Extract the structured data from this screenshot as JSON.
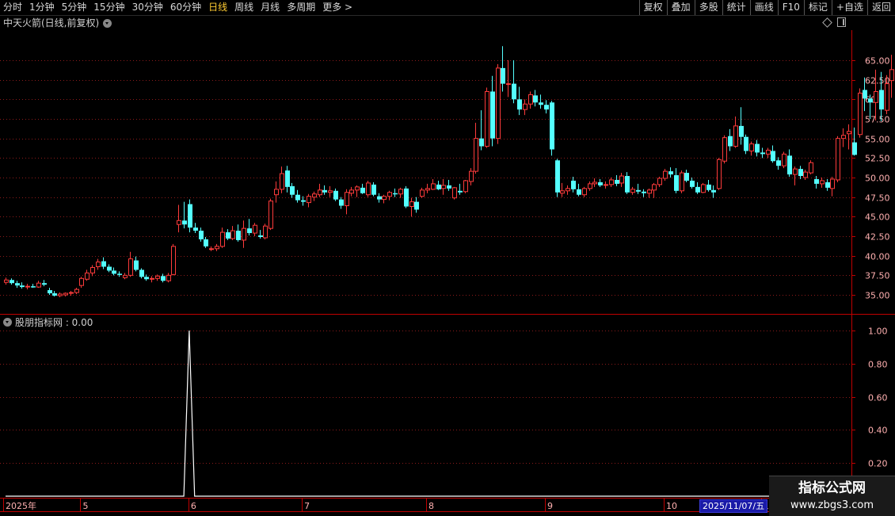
{
  "toolbar": {
    "left": [
      "分时",
      "1分钟",
      "5分钟",
      "15分钟",
      "30分钟",
      "60分钟",
      "日线",
      "周线",
      "月线",
      "多周期",
      "更多 >"
    ],
    "active": "日线",
    "right": [
      "复权",
      "叠加",
      "多股",
      "统计",
      "画线",
      "F10",
      "标记",
      "+自选",
      "返回"
    ]
  },
  "main_title": "中天火箭(日线,前复权)",
  "indicator_title": "股朋指标网 : 0.00",
  "date_highlight": "2025/11/07/五",
  "watermark": {
    "line1": "指标公式网",
    "line2": "www.zbgs3.com"
  },
  "colors": {
    "up": "#ff3b3b",
    "down": "#54ffff",
    "axis": "#c00000",
    "grid": "#8b1a1a",
    "label": "#ffb0b0",
    "line": "#ffffff"
  },
  "chart_data": [
    {
      "type": "candlestick",
      "title": "中天火箭(日线,前复权)",
      "ylim": [
        33.5,
        67.5
      ],
      "y_ticks": [
        "65.00",
        "62.50",
        "60.00",
        "57.50",
        "55.00",
        "52.50",
        "50.00",
        "47.50",
        "45.00",
        "42.50",
        "40.00",
        "37.50",
        "35.00"
      ],
      "x_labels": [
        {
          "label": "2025年",
          "index": 0
        },
        {
          "label": "5",
          "index": 14
        },
        {
          "label": "6",
          "index": 34
        },
        {
          "label": "7",
          "index": 55
        },
        {
          "label": "8",
          "index": 78
        },
        {
          "label": "9",
          "index": 100
        },
        {
          "label": "10",
          "index": 122
        },
        {
          "label": "11",
          "index": 140
        }
      ],
      "ohlc": [
        [
          36.6,
          37.2,
          36.3,
          36.9
        ],
        [
          36.9,
          37.1,
          36.3,
          36.5
        ],
        [
          36.5,
          36.8,
          35.9,
          36.2
        ],
        [
          36.2,
          36.6,
          35.8,
          36.0
        ],
        [
          36.0,
          36.4,
          35.7,
          36.1
        ],
        [
          36.1,
          36.4,
          35.9,
          36.0
        ],
        [
          36.0,
          36.8,
          35.9,
          36.5
        ],
        [
          36.5,
          36.9,
          36.1,
          36.3
        ],
        [
          35.6,
          35.9,
          35.0,
          35.2
        ],
        [
          35.2,
          35.5,
          34.8,
          34.9
        ],
        [
          34.9,
          35.3,
          34.7,
          35.1
        ],
        [
          35.0,
          35.3,
          34.8,
          35.2
        ],
        [
          35.2,
          35.5,
          34.9,
          35.3
        ],
        [
          35.3,
          35.9,
          35.1,
          35.7
        ],
        [
          36.2,
          37.3,
          35.9,
          37.1
        ],
        [
          37.0,
          38.2,
          36.8,
          37.8
        ],
        [
          37.8,
          38.8,
          37.4,
          38.5
        ],
        [
          38.6,
          39.6,
          38.2,
          39.2
        ],
        [
          39.3,
          39.8,
          38.3,
          38.6
        ],
        [
          38.6,
          38.9,
          37.9,
          38.1
        ],
        [
          38.1,
          38.5,
          37.5,
          37.7
        ],
        [
          37.7,
          38.0,
          37.3,
          37.6
        ],
        [
          37.2,
          37.8,
          37.0,
          37.5
        ],
        [
          37.5,
          40.5,
          37.3,
          39.6
        ],
        [
          39.4,
          39.9,
          38.0,
          38.2
        ],
        [
          38.2,
          38.4,
          37.1,
          37.3
        ],
        [
          37.3,
          37.6,
          36.8,
          37.0
        ],
        [
          37.0,
          37.4,
          36.6,
          37.1
        ],
        [
          37.1,
          37.6,
          36.8,
          37.4
        ],
        [
          37.4,
          37.7,
          36.6,
          36.8
        ],
        [
          36.8,
          37.8,
          36.6,
          37.5
        ],
        [
          37.6,
          41.5,
          37.5,
          41.2
        ],
        [
          44.0,
          46.5,
          43.0,
          44.5
        ],
        [
          44.5,
          46.9,
          43.5,
          44.0
        ],
        [
          46.6,
          47.2,
          43.0,
          43.6
        ],
        [
          43.6,
          44.2,
          42.9,
          43.2
        ],
        [
          43.2,
          43.6,
          41.8,
          42.1
        ],
        [
          42.1,
          42.4,
          41.0,
          41.2
        ],
        [
          40.8,
          41.2,
          40.6,
          40.9
        ],
        [
          40.9,
          41.5,
          40.6,
          41.2
        ],
        [
          41.2,
          43.6,
          41.0,
          43.0
        ],
        [
          43.0,
          43.4,
          42.0,
          42.2
        ],
        [
          42.2,
          43.8,
          42.0,
          43.2
        ],
        [
          43.2,
          44.0,
          41.8,
          42.0
        ],
        [
          42.0,
          44.5,
          41.0,
          43.5
        ],
        [
          43.5,
          44.7,
          42.6,
          42.9
        ],
        [
          42.9,
          44.2,
          42.5,
          43.9
        ],
        [
          42.6,
          43.3,
          42.2,
          42.4
        ],
        [
          42.3,
          44.1,
          42.1,
          43.8
        ],
        [
          43.5,
          47.3,
          43.3,
          47.0
        ],
        [
          47.8,
          49.5,
          46.8,
          48.5
        ],
        [
          48.5,
          51.4,
          48.0,
          50.5
        ],
        [
          50.9,
          51.5,
          48.1,
          48.8
        ],
        [
          48.9,
          49.3,
          47.4,
          47.8
        ],
        [
          47.8,
          48.4,
          46.8,
          47.1
        ],
        [
          47.1,
          47.6,
          46.4,
          46.9
        ],
        [
          46.8,
          47.9,
          46.2,
          47.6
        ],
        [
          47.5,
          48.2,
          47.0,
          47.9
        ],
        [
          47.8,
          49.2,
          47.5,
          48.4
        ],
        [
          48.4,
          49.0,
          47.8,
          48.1
        ],
        [
          48.1,
          48.9,
          47.5,
          48.3
        ],
        [
          48.3,
          48.6,
          47.0,
          47.2
        ],
        [
          47.2,
          47.5,
          46.0,
          46.4
        ],
        [
          46.4,
          48.5,
          45.3,
          48.1
        ],
        [
          48.0,
          48.8,
          47.6,
          48.4
        ],
        [
          48.4,
          49.0,
          47.5,
          48.8
        ],
        [
          48.7,
          49.2,
          47.9,
          48.0
        ],
        [
          47.8,
          49.6,
          47.5,
          49.3
        ],
        [
          49.1,
          49.4,
          47.6,
          47.8
        ],
        [
          47.6,
          48.0,
          46.8,
          47.2
        ],
        [
          47.2,
          47.8,
          46.7,
          47.6
        ],
        [
          47.6,
          48.3,
          47.1,
          48.1
        ],
        [
          48.0,
          48.6,
          47.5,
          47.9
        ],
        [
          47.9,
          48.7,
          47.4,
          48.5
        ],
        [
          48.6,
          48.9,
          46.1,
          46.3
        ],
        [
          46.3,
          47.4,
          45.0,
          46.9
        ],
        [
          46.9,
          47.5,
          45.5,
          45.9
        ],
        [
          47.6,
          48.7,
          47.4,
          48.4
        ],
        [
          48.4,
          49.2,
          48.0,
          48.6
        ],
        [
          48.5,
          49.8,
          48.4,
          49.2
        ],
        [
          49.1,
          49.6,
          48.4,
          48.5
        ],
        [
          48.6,
          49.8,
          47.8,
          49.0
        ],
        [
          49.0,
          49.7,
          48.3,
          48.6
        ],
        [
          47.4,
          48.8,
          47.2,
          48.7
        ],
        [
          48.3,
          49.2,
          47.8,
          48.1
        ],
        [
          48.2,
          49.7,
          48.0,
          49.6
        ],
        [
          49.5,
          51.2,
          49.0,
          50.8
        ],
        [
          50.8,
          57.0,
          50.5,
          55.0
        ],
        [
          55.0,
          58.6,
          53.5,
          54.0
        ],
        [
          54.0,
          61.5,
          53.8,
          61.0
        ],
        [
          61.0,
          63.0,
          54.0,
          55.0
        ],
        [
          55.0,
          64.5,
          54.3,
          64.0
        ],
        [
          64.0,
          66.8,
          61.0,
          62.0
        ],
        [
          61.9,
          65.0,
          60.3,
          62.0
        ],
        [
          62.0,
          65.0,
          59.5,
          60.0
        ],
        [
          60.0,
          61.6,
          58.0,
          58.7
        ],
        [
          58.7,
          60.0,
          58.0,
          59.4
        ],
        [
          59.4,
          61.0,
          58.8,
          60.6
        ],
        [
          60.5,
          61.2,
          59.1,
          59.6
        ],
        [
          59.6,
          60.6,
          58.8,
          59.3
        ],
        [
          59.3,
          59.9,
          58.2,
          58.7
        ],
        [
          59.6,
          59.8,
          52.8,
          53.6
        ],
        [
          52.2,
          52.4,
          47.5,
          48.1
        ],
        [
          48.0,
          49.3,
          47.5,
          48.3
        ],
        [
          48.3,
          49.0,
          47.8,
          48.6
        ],
        [
          49.6,
          50.1,
          48.1,
          48.5
        ],
        [
          48.5,
          49.2,
          47.6,
          47.8
        ],
        [
          47.8,
          48.8,
          47.5,
          48.6
        ],
        [
          48.6,
          49.5,
          48.3,
          49.2
        ],
        [
          49.2,
          49.9,
          48.8,
          49.4
        ],
        [
          49.4,
          49.8,
          48.8,
          49.0
        ],
        [
          49.0,
          49.5,
          48.6,
          49.1
        ],
        [
          49.1,
          50.0,
          48.8,
          49.7
        ],
        [
          49.7,
          50.3,
          48.9,
          49.2
        ],
        [
          49.3,
          50.6,
          48.8,
          50.2
        ],
        [
          50.2,
          50.7,
          47.9,
          48.1
        ],
        [
          48.1,
          48.8,
          47.8,
          48.5
        ],
        [
          48.4,
          49.2,
          47.9,
          48.2
        ],
        [
          48.2,
          48.5,
          47.5,
          48.0
        ],
        [
          48.0,
          48.6,
          47.4,
          48.4
        ],
        [
          48.4,
          49.3,
          47.4,
          49.1
        ],
        [
          49.1,
          50.1,
          48.8,
          49.9
        ],
        [
          49.9,
          51.1,
          49.6,
          50.8
        ],
        [
          50.8,
          51.3,
          50.0,
          50.4
        ],
        [
          50.3,
          51.2,
          48.0,
          48.3
        ],
        [
          48.3,
          50.9,
          48.0,
          50.6
        ],
        [
          50.6,
          51.0,
          49.4,
          49.6
        ],
        [
          49.6,
          50.0,
          48.6,
          48.8
        ],
        [
          48.8,
          49.4,
          47.9,
          48.1
        ],
        [
          48.1,
          49.3,
          48.0,
          49.1
        ],
        [
          49.1,
          49.7,
          48.2,
          48.4
        ],
        [
          48.4,
          49.0,
          47.4,
          48.1
        ],
        [
          48.6,
          52.5,
          48.4,
          52.3
        ],
        [
          52.1,
          55.4,
          51.8,
          55.1
        ],
        [
          55.3,
          56.2,
          53.4,
          54.0
        ],
        [
          54.0,
          57.8,
          53.8,
          56.6
        ],
        [
          56.6,
          59.0,
          54.2,
          55.2
        ],
        [
          55.2,
          55.5,
          53.0,
          53.4
        ],
        [
          53.4,
          54.6,
          52.8,
          54.3
        ],
        [
          54.3,
          54.8,
          52.7,
          53.2
        ],
        [
          53.2,
          53.8,
          52.5,
          53.0
        ],
        [
          53.0,
          53.8,
          52.5,
          53.5
        ],
        [
          53.4,
          54.1,
          51.9,
          52.1
        ],
        [
          52.2,
          52.6,
          51.0,
          51.5
        ],
        [
          51.5,
          53.3,
          51.2,
          53.0
        ],
        [
          52.8,
          53.6,
          50.1,
          50.4
        ],
        [
          50.4,
          51.4,
          49.0,
          51.1
        ],
        [
          51.1,
          51.5,
          49.8,
          50.2
        ],
        [
          50.0,
          51.0,
          49.7,
          50.7
        ],
        [
          50.6,
          52.2,
          50.4,
          51.9
        ],
        [
          49.8,
          50.2,
          48.6,
          49.2
        ],
        [
          49.2,
          50.0,
          48.7,
          49.6
        ],
        [
          49.4,
          49.8,
          48.3,
          48.7
        ],
        [
          48.6,
          50.1,
          47.6,
          49.8
        ],
        [
          49.7,
          55.3,
          49.4,
          55.0
        ],
        [
          55.0,
          56.3,
          53.9,
          55.4
        ],
        [
          55.6,
          56.8,
          53.6,
          55.9
        ],
        [
          54.5,
          56.4,
          52.8,
          52.9
        ],
        [
          55.5,
          61.4,
          55.1,
          60.8
        ],
        [
          61.2,
          62.8,
          58.5,
          60.1
        ],
        [
          60.1,
          60.6,
          57.5,
          59.6
        ],
        [
          59.6,
          63.8,
          57.3,
          61.0
        ],
        [
          61.2,
          63.5,
          57.2,
          58.7
        ],
        [
          58.6,
          63.1,
          58.1,
          62.0
        ],
        [
          62.4,
          65.7,
          60.2,
          63.8
        ],
        [
          63.8,
          65.3,
          60.7,
          61.6
        ],
        [
          61.8,
          65.8,
          61.3,
          62.8
        ],
        [
          63.0,
          64.3,
          59.2,
          61.8
        ],
        [
          61.8,
          64.6,
          60.4,
          61.1
        ],
        [
          61.1,
          67.1,
          58.5,
          64.7
        ],
        [
          60.3,
          64.0,
          59.8,
          63.7
        ]
      ]
    },
    {
      "type": "line",
      "title": "股朋指标网",
      "ylim": [
        0,
        1.05
      ],
      "y_ticks": [
        "1.00",
        "0.80",
        "0.60",
        "0.40",
        "0.20"
      ],
      "spike_index": 34,
      "values_note": "0 everywhere except index 34 = 1.00"
    }
  ]
}
